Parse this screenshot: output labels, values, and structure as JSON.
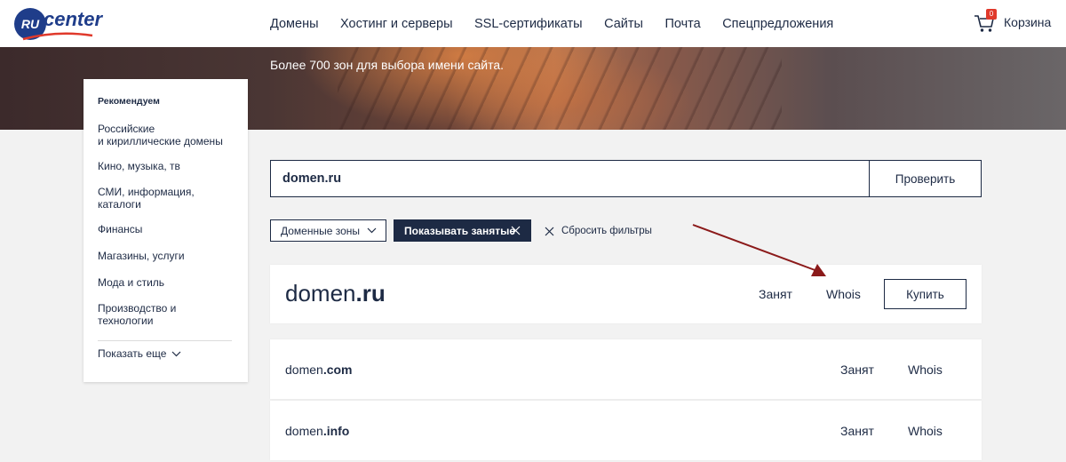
{
  "header": {
    "logo": {
      "badge": "RU",
      "text": "center"
    },
    "nav": [
      "Домены",
      "Хостинг и серверы",
      "SSL-сертификаты",
      "Сайты",
      "Почта",
      "Спецпредложения"
    ],
    "cart": {
      "count": "0",
      "label": "Корзина"
    }
  },
  "hero": {
    "subtitle": "Более 700 зон для выбора имени сайта."
  },
  "sidebar": {
    "heading": "Рекомендуем",
    "items": [
      "Российские\nи кириллические домены",
      "Кино, музыка, тв",
      "СМИ, информация,\nкаталоги",
      "Финансы",
      "Магазины, услуги",
      "Мода и стиль",
      "Производство и\nтехнологии"
    ],
    "show_more": "Показать еще"
  },
  "search": {
    "value": "domen.ru",
    "button": "Проверить"
  },
  "filters": {
    "zones": "Доменные зоны",
    "show_busy": "Показывать занятые",
    "reset": "Сбросить фильтры"
  },
  "results": {
    "main": {
      "name": "domen",
      "zone": ".ru",
      "status": "Занят",
      "whois": "Whois",
      "buy": "Купить"
    },
    "rows": [
      {
        "name": "domen",
        "zone": ".com",
        "status": "Занят",
        "whois": "Whois"
      },
      {
        "name": "domen",
        "zone": ".info",
        "status": "Занят",
        "whois": "Whois"
      }
    ]
  },
  "colors": {
    "accent": "#1d2a44",
    "brand": "#1f3d8a",
    "arrow": "#8b1a1a",
    "badge": "#e0392b"
  }
}
